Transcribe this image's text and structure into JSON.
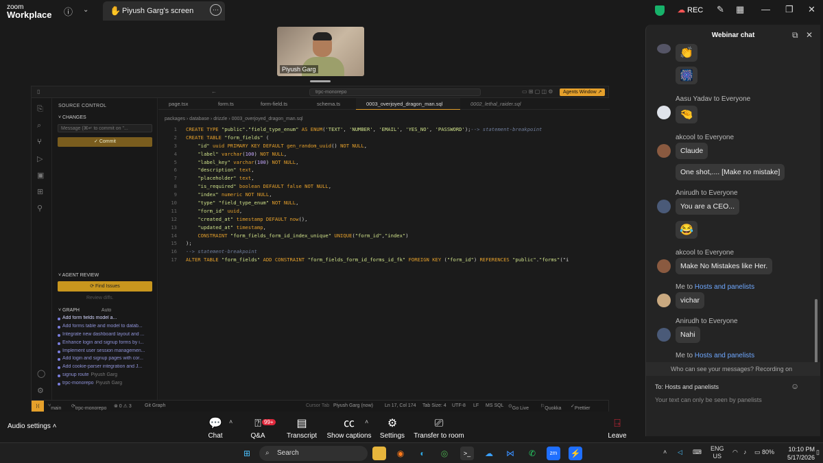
{
  "app": {
    "brand_top": "zoom",
    "brand_bottom": "Workplace",
    "share_tab": "Piyush Garg's screen",
    "rec": "REC"
  },
  "video": {
    "name": "Piyush Garg"
  },
  "ide": {
    "search": "trpc-monorepo",
    "agents_button": "Agents Window ↗",
    "source_control": "SOURCE CONTROL",
    "changes": "CHANGES",
    "message_placeholder": "Message (⌘↵ to commit on \"...",
    "commit": "✓ Commit",
    "agent_review": "AGENT REVIEW",
    "find_issues": "⟳ Find Issues",
    "review_diffs": "Review diffs.",
    "graph": "GRAPH",
    "graph_auto": "Auto",
    "graph_items": [
      {
        "t": "Add form fields model a...",
        "s": ""
      },
      {
        "t": "Add forms table and model to datab...",
        "s": ""
      },
      {
        "t": "Integrate new dashboard layout and ...",
        "s": ""
      },
      {
        "t": "Enhance login and signup forms by i...",
        "s": ""
      },
      {
        "t": "Implement user session managemen...",
        "s": ""
      },
      {
        "t": "Add login and signup pages with cor...",
        "s": ""
      },
      {
        "t": "Add cookie-parser integration and J...",
        "s": ""
      },
      {
        "t": "signup route",
        "s": "Piyush Garg"
      },
      {
        "t": "trpc-monorepo",
        "s": "Piyush Garg"
      }
    ],
    "tabs": [
      "page.tsx",
      "form.ts",
      "form-field.ts",
      "schema.ts",
      "0003_overjoyed_dragon_man.sql",
      "0002_lethal_raider.sql"
    ],
    "breadcrumb": "packages › database › drizzle › 0003_overjoyed_dragon_man.sql",
    "code": [
      "CREATE TYPE \"public\".\"field_type_enum\" AS ENUM('TEXT', 'NUMBER', 'EMAIL', 'YES_NO', 'PASSWORD');--> statement-breakpoint",
      "CREATE TABLE \"form_fields\" (",
      "    \"id\" uuid PRIMARY KEY DEFAULT gen_random_uuid() NOT NULL,",
      "    \"label\" varchar(100) NOT NULL,",
      "    \"label_key\" varchar(100) NOT NULL,",
      "    \"description\" text,",
      "    \"placeholder\" text,",
      "    \"is_required\" boolean DEFAULT false NOT NULL,",
      "    \"index\" numeric NOT NULL,",
      "    \"type\" \"field_type_enum\" NOT NULL,",
      "    \"form_id\" uuid,",
      "    \"created_at\" timestamp DEFAULT now(),",
      "    \"updated_at\" timestamp,",
      "    CONSTRAINT \"form_fields_form_id_index_unique\" UNIQUE(\"form_id\",\"index\")",
      ");",
      "--> statement-breakpoint",
      "ALTER TABLE \"form_fields\" ADD CONSTRAINT \"form_fields_form_id_forms_id_fk\" FOREIGN KEY (\"form_id\") REFERENCES \"public\".\"forms\"(\"i"
    ],
    "status": {
      "branch": "main",
      "repo": "trpc-monorepo",
      "counts": "⊗ 0 ⚠ 3",
      "git_graph": "Git Graph",
      "cursor_tab": "Cursor Tab",
      "user": "Piyush Garg (now)",
      "pos": "Ln 17, Col 174",
      "tab": "Tab Size: 4",
      "enc": "UTF-8",
      "eol": "LF",
      "lang": "MS SQL",
      "live": "Go Live",
      "quokka": "Quokka",
      "prettier": "Prettier"
    }
  },
  "toolbar": {
    "audio": "Audio settings",
    "chat": "Chat",
    "qa": "Q&A",
    "qa_badge": "99+",
    "transcript": "Transcript",
    "captions": "Show captions",
    "settings": "Settings",
    "transfer": "Transfer to room",
    "leave": "Leave"
  },
  "chat": {
    "title": "Webinar chat",
    "messages": [
      {
        "sender": "",
        "text": "👏",
        "emoji": true
      },
      {
        "sender": "",
        "text": "🎆",
        "emoji": true
      },
      {
        "sender": "Aasu Yadav to Everyone",
        "text": "🤏",
        "emoji": true
      },
      {
        "sender": "akcool to Everyone",
        "text": "Claude"
      },
      {
        "sender": "",
        "text": "One shot,.... [Make no mistake]"
      },
      {
        "sender": "Anirudh to Everyone",
        "text": "You are a CEO..."
      },
      {
        "sender": "",
        "text": "😂",
        "emoji": true
      },
      {
        "sender": "akcool to Everyone",
        "text": "Make No Mistakes like Her."
      },
      {
        "sender_prefix": "Me to ",
        "sender_link": "Hosts and panelists",
        "text": "vichar"
      },
      {
        "sender": "Anirudh to Everyone",
        "text": "Nahi"
      },
      {
        "sender_prefix": "Me to ",
        "sender_link": "Hosts and panelists"
      }
    ],
    "notice": "Who can see your messages? Recording on",
    "to": "To:  Hosts and panelists",
    "hint": "Your text can only be seen by panelists"
  },
  "taskbar": {
    "search": "Search",
    "lang1": "ENG",
    "lang2": "US",
    "battery": "80%",
    "time": "10:10 PM",
    "date": "5/17/2026"
  }
}
